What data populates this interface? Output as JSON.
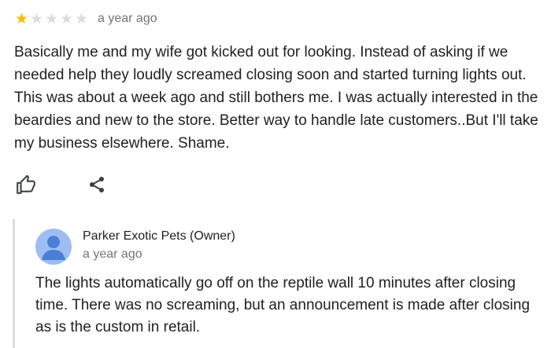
{
  "review": {
    "rating": 1,
    "max_rating": 5,
    "star_glyph": "★",
    "time_ago": "a year ago",
    "text_lines": [
      "Basically me and my wife got kicked out for looking. Instead of asking if we",
      "needed help they loudly screamed closing soon and started turning lights out.",
      "This was about a week ago and still bothers me. I was actually interested in the",
      "beardies and new to the store. Better way to handle late customers..But I'll take",
      "my business elsewhere. Shame."
    ]
  },
  "actions": {
    "like_icon": "thumbs-up-icon",
    "share_icon": "share-icon"
  },
  "reply": {
    "owner_name": "Parker Exotic Pets (Owner)",
    "time_ago": "a year ago",
    "avatar_icon": "person-icon",
    "text_lines": [
      "The lights automatically go off on the reptile wall 10 minutes after closing",
      "time. There was no screaming, but an announcement is made after closing",
      "as is the custom in retail."
    ]
  },
  "colors": {
    "star_filled": "#fbbc04",
    "star_empty": "#dadce0",
    "avatar_bg": "#9fbdf2",
    "avatar_fg": "#4a7fd6",
    "muted_text": "#70757a"
  }
}
